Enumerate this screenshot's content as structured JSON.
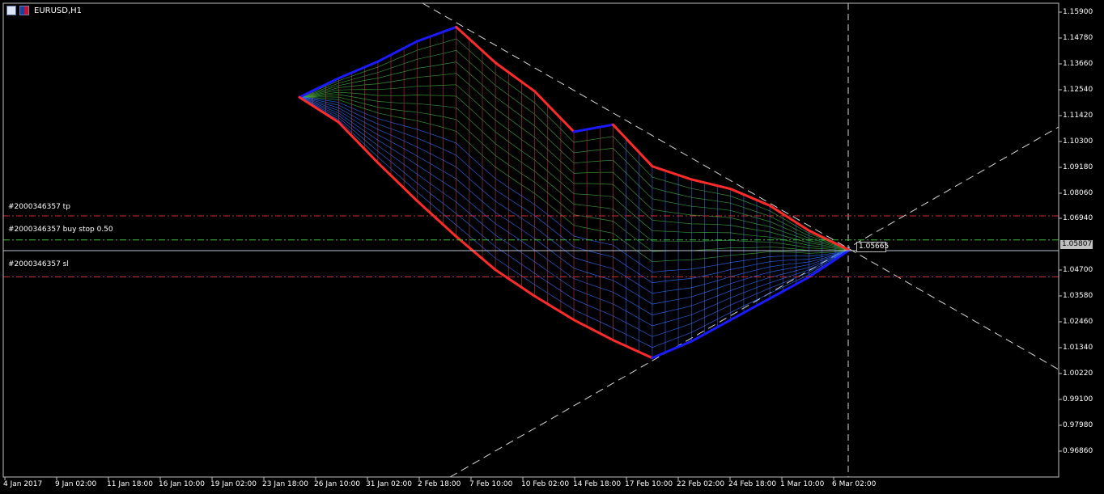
{
  "window": {
    "title": "EURUSD,H1",
    "icons": [
      "table-icon",
      "flag-icon"
    ]
  },
  "colors": {
    "background": "#000000",
    "axis": "#c0c0c0",
    "up_line": "#ff2a2a",
    "down_line": "#1a1aff",
    "mesh_red": "#c04040",
    "mesh_green": "#3fa83f",
    "mesh_blue": "#2f6dff",
    "tp_sl_line": "#d03030",
    "buy_stop_line": "#3fbf3f",
    "bid_line": "#b8c4d4"
  },
  "orders": {
    "tp_label": "#2000346357 tp",
    "buy_stop_label": "#2000346357 buy stop 0.50",
    "sl_label": "#2000346357 sl"
  },
  "price_axis": {
    "labels": [
      "1.15900",
      "1.14780",
      "1.13660",
      "1.12540",
      "1.11420",
      "1.10300",
      "1.09180",
      "1.08060",
      "1.06940",
      "1.04700",
      "1.03580",
      "1.02460",
      "1.01340",
      "1.00220",
      "0.99100",
      "0.97980",
      "0.96860"
    ],
    "bid_label": "1.05807",
    "crosshair_label": "1.05665"
  },
  "time_axis": {
    "labels": [
      "4 Jan 2017",
      "9 Jan 02:00",
      "11 Jan 18:00",
      "16 Jan 10:00",
      "19 Jan 02:00",
      "23 Jan 18:00",
      "26 Jan 10:00",
      "31 Jan 02:00",
      "2 Feb 18:00",
      "7 Feb 10:00",
      "10 Feb 02:00",
      "14 Feb 18:00",
      "17 Feb 10:00",
      "22 Feb 02:00",
      "24 Feb 18:00",
      "1 Mar 10:00",
      "6 Mar 02:00"
    ]
  },
  "chart_data": {
    "type": "line",
    "symbol": "EURUSD",
    "timeframe": "H1",
    "ylim": [
      0.963,
      1.162
    ],
    "x": [
      "2017-01-24",
      "2017-01-27",
      "2017-01-31",
      "2017-02-03",
      "2017-02-06",
      "2017-02-09",
      "2017-02-12",
      "2017-02-15",
      "2017-02-18",
      "2017-02-21",
      "2017-02-23",
      "2017-02-26",
      "2017-02-28",
      "2017-03-03",
      "2017-03-06"
    ],
    "series": [
      {
        "values": [
          1.1225,
          1.1305,
          1.1375,
          1.146,
          1.152,
          1.137,
          1.125,
          1.108,
          1.111,
          1.0935,
          1.088,
          1.084,
          1.077,
          1.0665,
          1.0585
        ]
      },
      {
        "values": [
          1.1225,
          1.112,
          1.095,
          1.079,
          1.064,
          1.05,
          1.039,
          1.029,
          1.0205,
          1.013,
          1.02,
          1.029,
          1.038,
          1.047,
          1.058
        ]
      }
    ],
    "levels": {
      "tp": 1.0727,
      "buy_stop": 1.0626,
      "bid": 1.05807,
      "sl": 1.0471,
      "crosshair_price": 1.05665,
      "crosshair_time": "6 Mar 02:00"
    },
    "grid": false
  }
}
